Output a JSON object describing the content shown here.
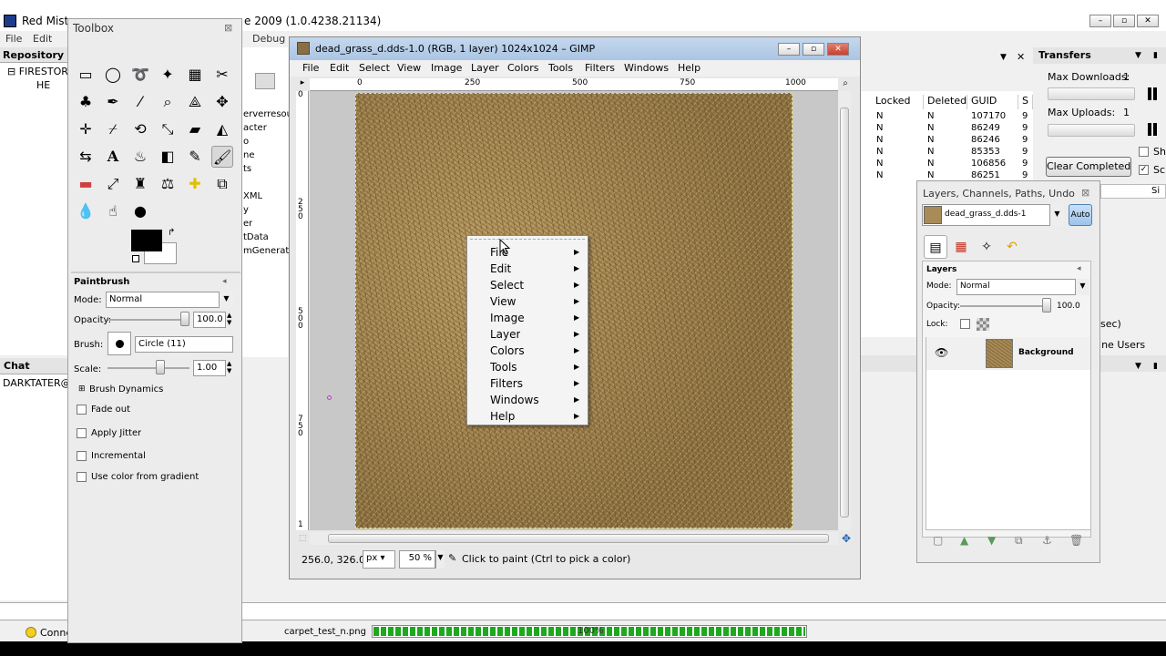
{
  "background_app": {
    "title": "Red Mist",
    "title_suffix": "e 2009 (1.0.4238.21134)",
    "menus": [
      "File",
      "Edit",
      "Debug"
    ],
    "repository_header": "Repository L",
    "tree_root": "FIRESTOR",
    "tree_child": "HE",
    "middle_items": [
      "erverresour",
      "acter",
      "o",
      "ne",
      "ts",
      "XML",
      "y",
      "er",
      "tData",
      "mGenerate"
    ],
    "chat_header": "Chat",
    "chat_user": "DARKTATER@",
    "status_connection": "Conne",
    "table": {
      "columns": [
        "Locked",
        "Deleted",
        "GUID",
        "S"
      ],
      "rows": [
        [
          "N",
          "N",
          "107170",
          "9"
        ],
        [
          "N",
          "N",
          "86249",
          "9"
        ],
        [
          "N",
          "N",
          "86246",
          "9"
        ],
        [
          "N",
          "N",
          "85353",
          "9"
        ],
        [
          "N",
          "N",
          "106856",
          "9"
        ],
        [
          "N",
          "N",
          "86251",
          "9"
        ]
      ]
    },
    "transfers": {
      "header": "Transfers",
      "max_downloads_label": "Max Downloads:",
      "max_downloads_value": "1",
      "max_uploads_label": "Max Uploads:",
      "max_uploads_value": "1",
      "clear_button": "Clear Completed",
      "size_col": "Si",
      "chk1": "Sh",
      "chk2": "Sc"
    },
    "sec_text": "sec)",
    "online_users": "nline Users",
    "transfer_file": "carpet_test_n.png",
    "transfer_progress_text": "100%",
    "transfer_progress": 1.0
  },
  "toolbox": {
    "title": "Toolbox",
    "tool_options_title": "Paintbrush",
    "mode_label": "Mode:",
    "mode_value": "Normal",
    "opacity_label": "Opacity:",
    "opacity_value": "100.0",
    "opacity_fraction": 1.0,
    "brush_label": "Brush:",
    "brush_value": "Circle (11)",
    "scale_label": "Scale:",
    "scale_value": "1.00",
    "brush_dynamics": "Brush Dynamics",
    "fade_out": "Fade out",
    "apply_jitter": "Apply Jitter",
    "incremental": "Incremental",
    "use_color_gradient": "Use color from gradient",
    "colors": {
      "foreground": "#000000",
      "background": "#ffffff"
    }
  },
  "image_window": {
    "title": "dead_grass_d.dds-1.0 (RGB, 1 layer) 1024x1024 – GIMP",
    "menus": [
      "File",
      "Edit",
      "Select",
      "View",
      "Image",
      "Layer",
      "Colors",
      "Tools",
      "Filters",
      "Windows",
      "Help"
    ],
    "ruler_h": [
      "0",
      "250",
      "500",
      "750",
      "1000"
    ],
    "ruler_v": [
      "0",
      "2\n5\n0",
      "5\n0\n0",
      "7\n5\n0",
      "1"
    ],
    "coords": "256.0, 326.0",
    "unit": "px",
    "zoom": "50 %",
    "status_message": "Click to paint (Ctrl to pick a color)"
  },
  "context_menu": {
    "items": [
      "File",
      "Edit",
      "Select",
      "View",
      "Image",
      "Layer",
      "Colors",
      "Tools",
      "Filters",
      "Windows",
      "Help"
    ]
  },
  "layers_dock": {
    "title": "Layers, Channels, Paths, Undo",
    "image_selector": "dead_grass_d.dds-1",
    "auto_button": "Auto",
    "section_title": "Layers",
    "mode_label": "Mode:",
    "mode_value": "Normal",
    "opacity_label": "Opacity:",
    "opacity_value": "100.0",
    "opacity_fraction": 1.0,
    "lock_label": "Lock:",
    "layer_name": "Background"
  }
}
